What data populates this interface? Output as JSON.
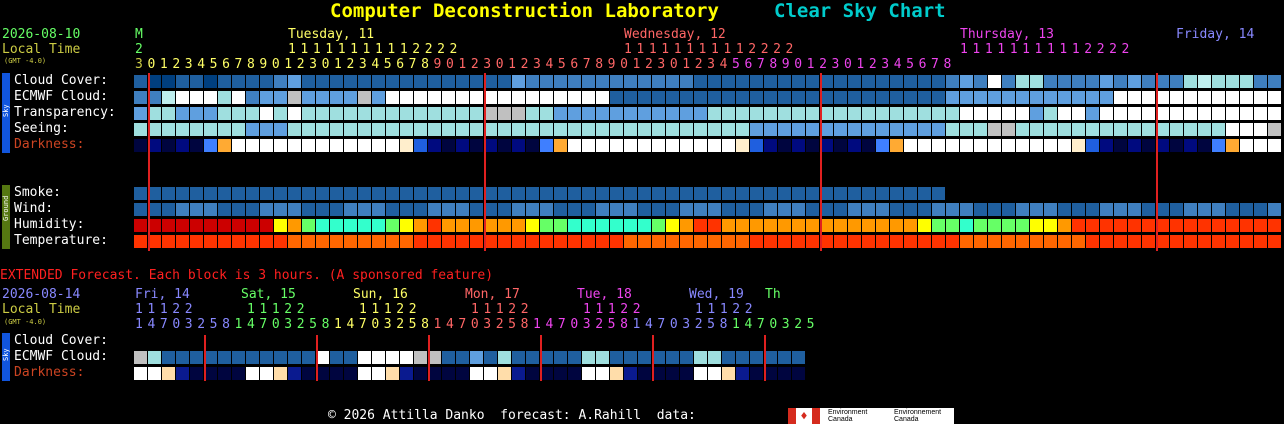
{
  "header": {
    "title": "Computer Deconstruction Laboratory",
    "subtitle": "Clear Sky Chart",
    "title_color": "#ffff00",
    "subtitle_color": "#00cccc"
  },
  "main": {
    "date": "2026-08-10",
    "local_time": "Local Time",
    "gmt_note": "(GMT -4.0)",
    "day_m": "M",
    "day_m2": "2",
    "days": [
      {
        "label": "Tuesday, 11",
        "color": "#ffff66"
      },
      {
        "label": "Wednesday, 12",
        "color": "#ff6666"
      },
      {
        "label": "Thursday, 13",
        "color": "#ee44ee"
      },
      {
        "label": "Friday, 14",
        "color": "#8888ff"
      }
    ],
    "hour_tens_row": "11111111112222",
    "hour_units_row": "301234567890123012345678901230123456789012301234567890123012345678",
    "row_labels": {
      "cloud": "Cloud Cover:",
      "ecmwf": "ECMWF Cloud:",
      "transparency": "Transparency:",
      "seeing": "Seeing:",
      "darkness": "Darkness:",
      "smoke": "Smoke:",
      "wind": "Wind:",
      "humidity": "Humidity:",
      "temperature": "Temperature:"
    },
    "side_labels": {
      "sky": "Sky",
      "ground": "Ground"
    }
  },
  "extended": {
    "heading": "EXTENDED Forecast. Each block is 3 hours. (A sponsored feature)",
    "heading_color": "#ff2020",
    "date": "2026-08-14",
    "local_time": "Local Time",
    "gmt_note": "(GMT -4.0)",
    "days": [
      {
        "label": "Fri, 14",
        "color": "#8888ff"
      },
      {
        "label": "Sat, 15",
        "color": "#66ff66"
      },
      {
        "label": "Sun, 16",
        "color": "#ffff66"
      },
      {
        "label": "Mon, 17",
        "color": "#ff6666"
      },
      {
        "label": "Tue, 18",
        "color": "#ee44ee"
      },
      {
        "label": "Wed, 19",
        "color": "#8888ff"
      },
      {
        "label": "Th",
        "color": "#66ff66"
      }
    ],
    "tens_row": "11122",
    "units_row": "1470325814703258147032581470325814703258147032581470325",
    "row_labels": {
      "cloud": "Cloud Cover:",
      "ecmwf": "ECMWF Cloud:",
      "darkness": "Darkness:"
    },
    "side_labels": {
      "sky": "Sky"
    }
  },
  "footer": {
    "text": "© 2026 Attilla Danko  forecast: A.Rahill  data:",
    "logo_text_en": "Environment Canada",
    "logo_text_fr": "Environnement Canada"
  }
}
